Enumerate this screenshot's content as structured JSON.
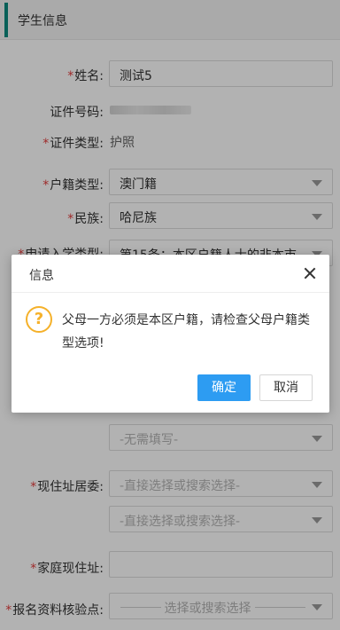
{
  "section": {
    "title": "学生信息"
  },
  "form": {
    "name": {
      "label": "姓名:",
      "value": "测试5"
    },
    "id_number": {
      "label": "证件号码:",
      "value": ""
    },
    "id_type": {
      "label": "证件类型:",
      "value": "护照"
    },
    "household_type": {
      "label": "户籍类型:",
      "value": "澳门籍"
    },
    "ethnicity": {
      "label": "民族:",
      "value": "哈尼族"
    },
    "application_type": {
      "label": "申请入学类型:",
      "value": "第15条：本区户籍人士的非本市..."
    },
    "no_need_placeholder": "-无需填写-",
    "address_committee": {
      "label": "现住址居委:",
      "placeholder1": "-直接选择或搜索选择-",
      "placeholder2": "-直接选择或搜索选择-"
    },
    "home_address": {
      "label": "家庭现住址:",
      "value": ""
    },
    "verification_site": {
      "label": "报名资料核验点:",
      "placeholder": "选择或搜索选择"
    }
  },
  "dialog": {
    "title": "信息",
    "message": "父母一方必须是本区户籍，请检查父母户籍类型选项!",
    "confirm_label": "确定",
    "cancel_label": "取消"
  },
  "colors": {
    "accent": "#0e8a7e",
    "primary_button": "#2d9cf2",
    "warning": "#f5b12a",
    "required": "#e23c3c"
  }
}
